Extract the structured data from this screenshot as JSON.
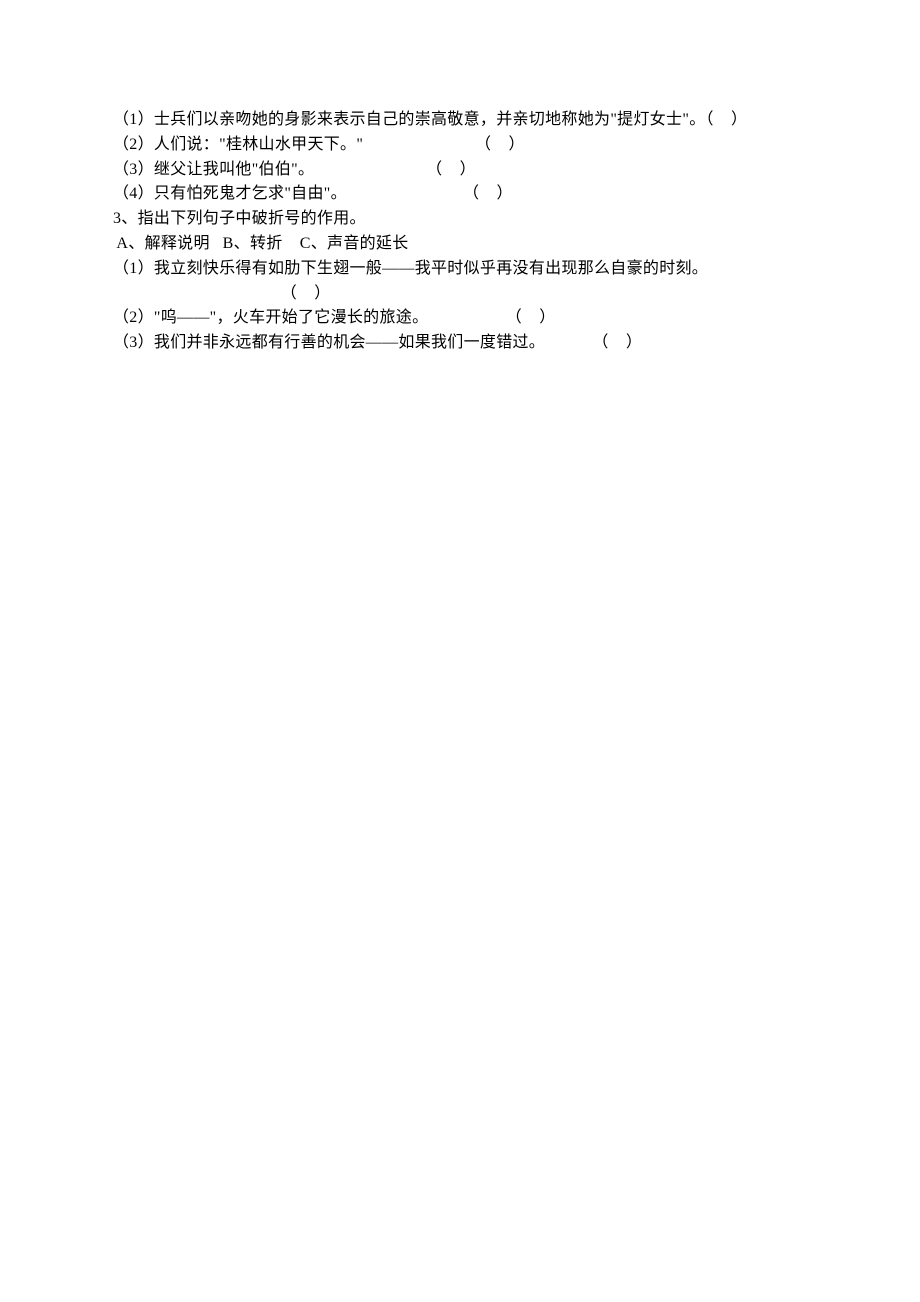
{
  "question2": {
    "items": [
      {
        "prefix": "（1）",
        "text_part1": "士兵们以亲吻她的身影来表示自己的崇高敬意，并亲切地称她为",
        "quoted": "\"提灯女士\"",
        "after_quote": "。",
        "bracket": "（    ）",
        "gap": ""
      },
      {
        "prefix": "（2）",
        "text_part1": "人们说：",
        "quoted": "\"桂林山水甲天下。\"",
        "after_quote": "",
        "bracket": "（    ）",
        "gap": "                          "
      },
      {
        "prefix": "（3）",
        "text_part1": "继父让我叫他",
        "quoted": "\"伯伯\"",
        "after_quote": "。",
        "bracket": "（    ）",
        "gap": "                          "
      },
      {
        "prefix": "（4）",
        "text_part1": "只有怕死鬼才乞求",
        "quoted": "\"自由\"",
        "after_quote": "。",
        "bracket": "（    ）",
        "gap": "                           "
      }
    ]
  },
  "question3": {
    "number": "3、",
    "prompt": "指出下列句子中破折号的作用。",
    "options_line": " A、解释说明   B、转折    C、声音的延长",
    "items": [
      {
        "prefix": "（1）",
        "text": "我立刻快乐得有如肋下生翅一般——我平时似乎再没有出现那么自豪的时刻。",
        "bracket": "（    ）",
        "bracket_indent": "                                       ",
        "wrap": true
      },
      {
        "prefix": "（2）",
        "text": "\"呜——\"，火车开始了它漫长的旅途。",
        "bracket": "（    ）",
        "gap": "                  ",
        "wrap": false
      },
      {
        "prefix": "（3）",
        "text": "我们并非永远都有行善的机会——如果我们一度错过。",
        "bracket": "（    ）",
        "gap": "           ",
        "wrap": false
      }
    ]
  }
}
